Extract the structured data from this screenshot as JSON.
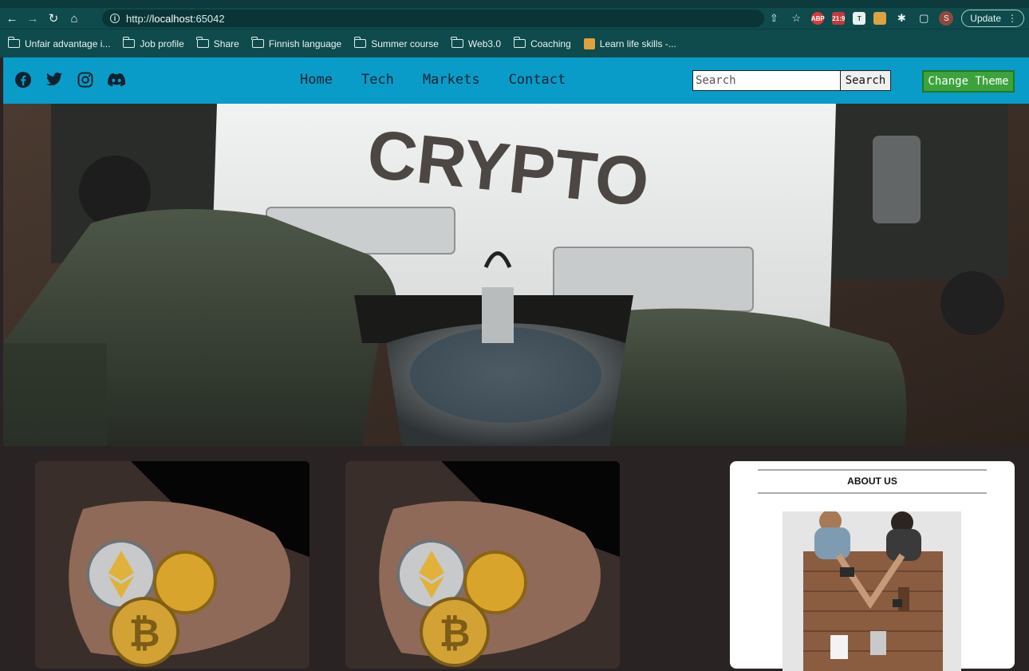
{
  "browser": {
    "url_scheme": "http://",
    "url_host": "localhost",
    "url_port": ":65042",
    "update_label": "Update",
    "profile_initial": "S",
    "bookmarks": [
      {
        "label": "Unfair advantage i...",
        "icon": "folder-icon"
      },
      {
        "label": "Job profile",
        "icon": "folder-icon"
      },
      {
        "label": "Share",
        "icon": "folder-icon"
      },
      {
        "label": "Finnish language",
        "icon": "folder-icon"
      },
      {
        "label": "Summer course",
        "icon": "folder-icon"
      },
      {
        "label": "Web3.0",
        "icon": "folder-icon"
      },
      {
        "label": "Coaching",
        "icon": "folder-icon"
      },
      {
        "label": "Learn life skills -...",
        "icon": "site-favicon"
      }
    ],
    "extensions": [
      "ABP",
      "21:9",
      "T"
    ]
  },
  "site": {
    "social": [
      "facebook-icon",
      "twitter-icon",
      "instagram-icon",
      "discord-icon"
    ],
    "nav": [
      "Home",
      "Tech",
      "Markets",
      "Contact"
    ],
    "search_placeholder": "Search",
    "search_button": "Search",
    "theme_button": "Change Theme",
    "hero_text": "CRYPTO",
    "about_title": "ABOUT US",
    "colors": {
      "header_bg": "#099cc8",
      "page_bg": "#2a2324",
      "theme_button_bg": "#3ca33c",
      "chrome_bg": "#0f4a4c"
    }
  }
}
